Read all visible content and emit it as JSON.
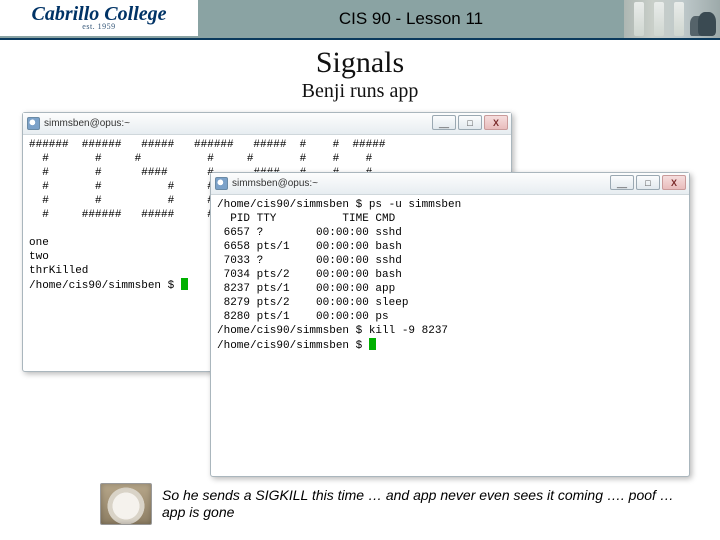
{
  "header": {
    "logo_text": "Cabrillo College",
    "logo_sub": "est. 1959",
    "course": "CIS 90 - Lesson 11"
  },
  "slide": {
    "title": "Signals",
    "subtitle": "Benji runs app"
  },
  "term_back": {
    "title": "simmsben@opus:~",
    "lines": [
      "######  ######   #####   ######   #####  #    #  #####",
      "  #       #     #          #     #       #    #    #",
      "  #       #      ####      #      ####   #    #    #",
      "  #       #          #     #          #  ######    #",
      "  #       #          #     #          #  #    #    #",
      "  #     ######   #####     #      #####  #    #  #####",
      "",
      "one",
      "two",
      "thrKilled"
    ],
    "prompt": "/home/cis90/simmsben $ "
  },
  "term_front": {
    "title": "simmsben@opus:~",
    "lines": [
      "/home/cis90/simmsben $ ps -u simmsben",
      "  PID TTY          TIME CMD",
      " 6657 ?        00:00:00 sshd",
      " 6658 pts/1    00:00:00 bash",
      " 7033 ?        00:00:00 sshd",
      " 7034 pts/2    00:00:00 bash",
      " 8237 pts/1    00:00:00 app",
      " 8279 pts/2    00:00:00 sleep",
      " 8280 pts/1    00:00:00 ps",
      "/home/cis90/simmsben $ kill -9 8237"
    ],
    "prompt": "/home/cis90/simmsben $ "
  },
  "window_buttons": {
    "min": "__",
    "max": "□",
    "close": "X"
  },
  "caption": "So he sends a SIGKILL this time … and app never even sees it coming …. poof … app is gone"
}
